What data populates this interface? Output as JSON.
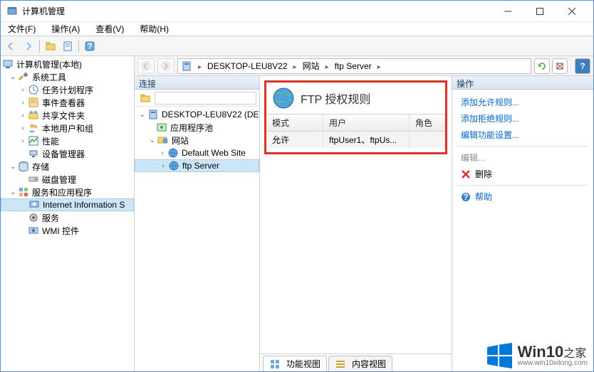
{
  "window": {
    "title": "计算机管理"
  },
  "menus": {
    "file": "文件(F)",
    "operate": "操作(A)",
    "view": "查看(V)",
    "help": "帮助(H)"
  },
  "leftTree": {
    "root": "计算机管理(本地)",
    "systemTools": "系统工具",
    "taskScheduler": "任务计划程序",
    "eventViewer": "事件查看器",
    "sharedFolders": "共享文件夹",
    "localUsersGroups": "本地用户和组",
    "perf": "性能",
    "deviceMgr": "设备管理器",
    "storage": "存储",
    "diskMgmt": "磁盘管理",
    "servicesApps": "服务和应用程序",
    "iis": "Internet Information S",
    "services": "服务",
    "wmi": "WMI 控件"
  },
  "crumbs": {
    "host": "DESKTOP-LEU8V22",
    "sites": "网站",
    "site": "ftp Server"
  },
  "connPanel": {
    "title": "连接",
    "host": "DESKTOP-LEU8V22 (DE",
    "appPools": "应用程序池",
    "sites": "网站",
    "defaultSite": "Default Web Site",
    "ftpSite": "ftp Server"
  },
  "ftpRules": {
    "title": "FTP 授权规则",
    "headers": {
      "mode": "模式",
      "user": "用户",
      "role": "角色"
    },
    "row": {
      "mode": "允许",
      "user": "ftpUser1、ftpUs...",
      "role": ""
    }
  },
  "tabs": {
    "feature": "功能视图",
    "content": "内容视图"
  },
  "actions": {
    "title": "操作",
    "addAllow": "添加允许规则...",
    "addDeny": "添加拒绝规则...",
    "editFeature": "编辑功能设置...",
    "edit": "编辑...",
    "delete": "删除",
    "help": "帮助"
  },
  "watermark": {
    "big": "Win10",
    "zhijia": "之家",
    "url": "www.win10xitong.com"
  }
}
